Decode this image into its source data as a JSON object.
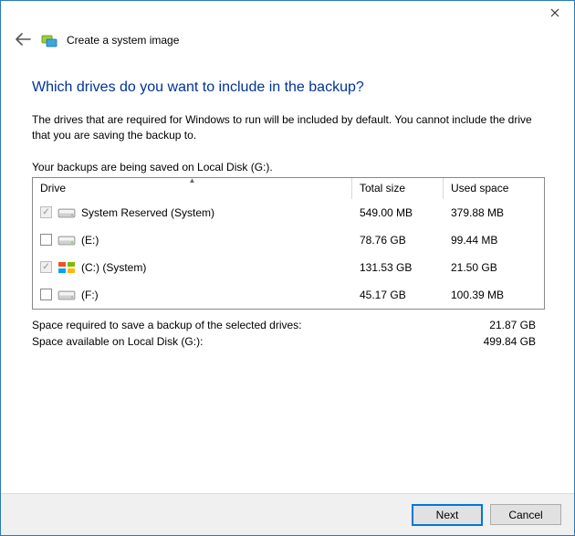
{
  "window": {
    "title": "Create a system image"
  },
  "heading": "Which drives do you want to include in the backup?",
  "description": "The drives that are required for Windows to run will be included by default. You cannot include the drive that you are saving the backup to.",
  "saving_on": "Your backups are being saved on Local Disk (G:).",
  "columns": {
    "drive": "Drive",
    "total": "Total size",
    "used": "Used space"
  },
  "drives": [
    {
      "label": "System Reserved (System)",
      "total": "549.00 MB",
      "used": "379.88 MB",
      "checked": true,
      "disabled": true,
      "os_icon": false
    },
    {
      "label": "(E:)",
      "total": "78.76 GB",
      "used": "99.44 MB",
      "checked": false,
      "disabled": false,
      "os_icon": false
    },
    {
      "label": "(C:) (System)",
      "total": "131.53 GB",
      "used": "21.50 GB",
      "checked": true,
      "disabled": true,
      "os_icon": true
    },
    {
      "label": "(F:)",
      "total": "45.17 GB",
      "used": "100.39 MB",
      "checked": false,
      "disabled": false,
      "os_icon": false
    }
  ],
  "summary": {
    "required_label": "Space required to save a backup of the selected drives:",
    "required_value": "21.87 GB",
    "available_label": "Space available on Local Disk (G:):",
    "available_value": "499.84 GB"
  },
  "buttons": {
    "next": "Next",
    "cancel": "Cancel"
  }
}
